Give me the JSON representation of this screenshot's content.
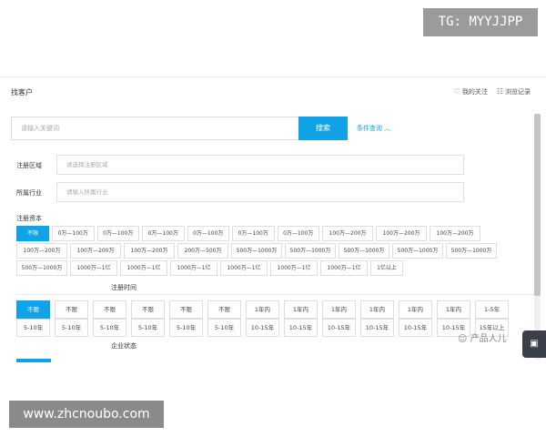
{
  "watermark_top": "TG: MYYJJPP",
  "watermark_bottom": "www.zhcnoubo.com",
  "header": {
    "title": "找客户",
    "my_follow": "我的关注",
    "history": "浏览记录"
  },
  "search": {
    "placeholder": "请输入关键词",
    "button": "搜索",
    "advanced": "条件查询"
  },
  "filters": {
    "region_label": "注册区域",
    "region_placeholder": "请选择注册区域",
    "industry_label": "所属行业",
    "industry_placeholder": "请输入所属行业",
    "capital_label": "注册资本",
    "capital_chips_row1": [
      "不限",
      "0万—100万",
      "0万—100万",
      "0万—100万",
      "0万—100万",
      "0万—100万",
      "0万—100万",
      "100万—200万",
      "100万—200万",
      "100万—200万"
    ],
    "capital_chips_row2": [
      "100万—200万",
      "100万—200万",
      "100万—200万",
      "200万—500万",
      "500万—1000万",
      "500万—1000万",
      "500万—1000万",
      "500万—1000万",
      "500万—1000万"
    ],
    "capital_chips_row3": [
      "500万—1000万",
      "1000万—1亿",
      "1000万—1亿",
      "1000万—1亿",
      "1000万—1亿",
      "1000万—1亿",
      "1000万—1亿",
      "1亿以上"
    ],
    "time_label": "注册时间",
    "time_chips_row1": [
      "不限",
      "不限",
      "不限",
      "不限",
      "不限",
      "不限",
      "1年内",
      "1年内",
      "1年内",
      "1年内",
      "1年内",
      "1年内",
      "1-5年"
    ],
    "time_chips_row2": [
      "5-10年",
      "5-10年",
      "5-10年",
      "5-10年",
      "5-10年",
      "5-10年",
      "10-15年",
      "10-15年",
      "10-15年",
      "10-15年",
      "10-15年",
      "10-15年",
      "15年以上"
    ],
    "status_label": "企业状态"
  },
  "wechat_badge": "产品人儿",
  "icons": {
    "heart": "heart-icon",
    "list": "list-icon",
    "chevron": "chevron-up-icon",
    "chat": "chat-icon"
  },
  "colors": {
    "accent": "#11a3e5"
  }
}
